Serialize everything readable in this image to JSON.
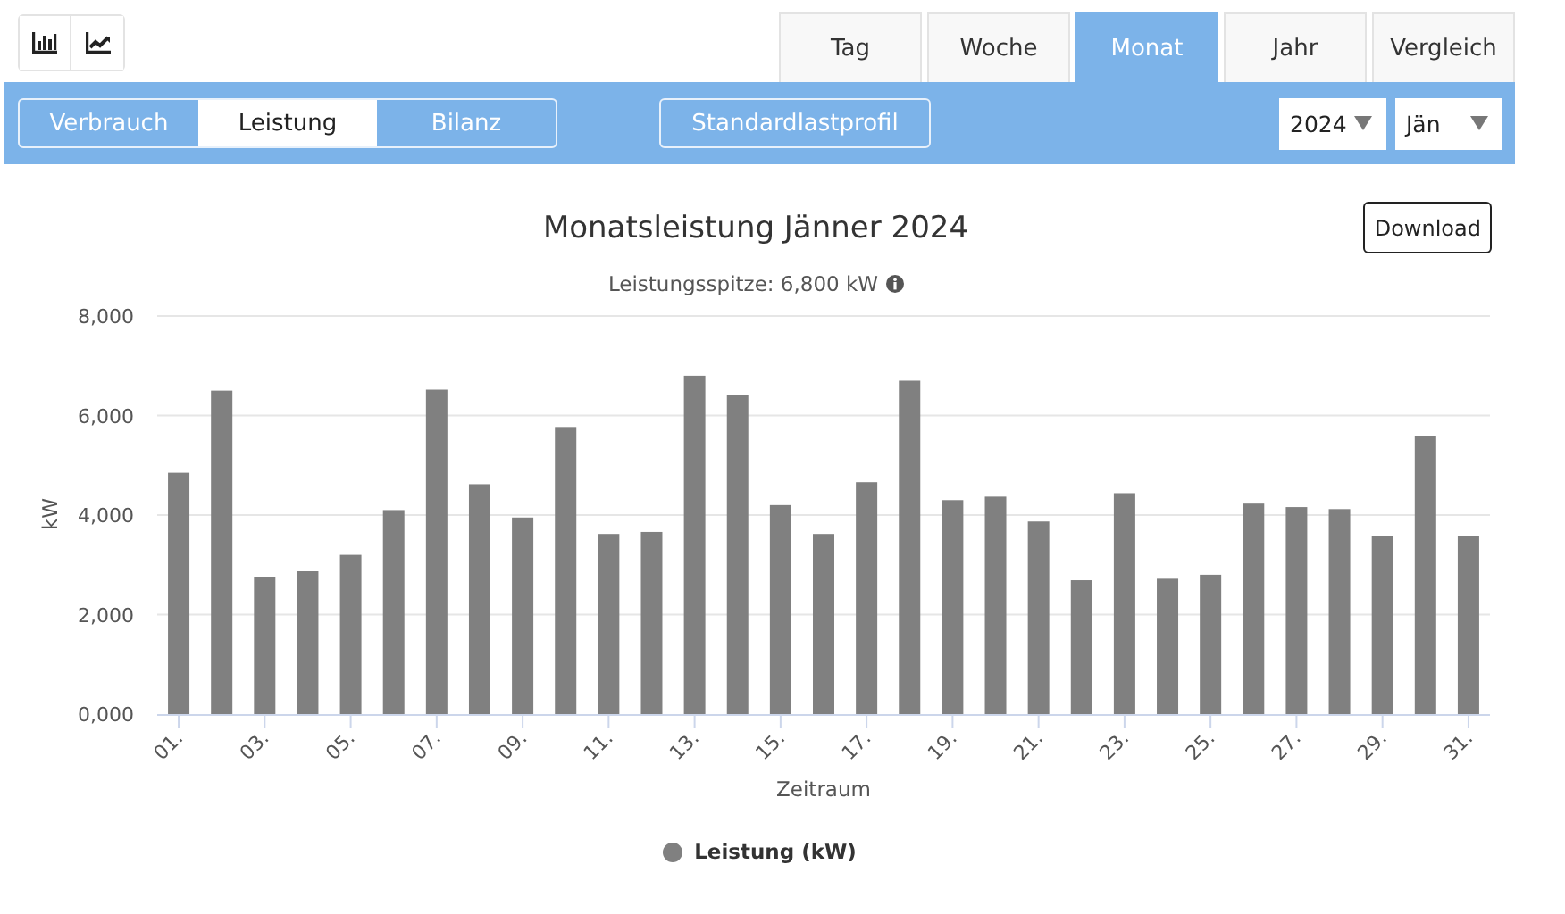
{
  "view_toggle": [
    {
      "kind": "bar",
      "selected": false
    },
    {
      "kind": "line",
      "selected": false
    }
  ],
  "period_tabs": [
    {
      "label": "Tag",
      "selected": false
    },
    {
      "label": "Woche",
      "selected": false
    },
    {
      "label": "Monat",
      "selected": true
    },
    {
      "label": "Jahr",
      "selected": false
    },
    {
      "label": "Vergleich",
      "selected": false
    }
  ],
  "mode_tabs": [
    {
      "label": "Verbrauch",
      "selected": false
    },
    {
      "label": "Leistung",
      "selected": true
    },
    {
      "label": "Bilanz",
      "selected": false
    }
  ],
  "profile_button": "Standardlastprofil",
  "year_select": {
    "value": "2024"
  },
  "month_select": {
    "value": "Jän"
  },
  "download_button": "Download",
  "chart": {
    "subtitle": "Leistungsspitze: 6,800 kW",
    "chart_data": {
      "type": "bar",
      "title": "Monatsleistung Jänner 2024",
      "xlabel": "Zeitraum",
      "ylabel": "kW",
      "ylim": [
        0,
        8000
      ],
      "yticks": [
        {
          "value": 0,
          "label": "0,000"
        },
        {
          "value": 2000,
          "label": "2,000"
        },
        {
          "value": 4000,
          "label": "4,000"
        },
        {
          "value": 6000,
          "label": "6,000"
        },
        {
          "value": 8000,
          "label": "8,000"
        }
      ],
      "grid": true,
      "x": [
        1,
        2,
        3,
        4,
        5,
        6,
        7,
        8,
        9,
        10,
        11,
        12,
        13,
        14,
        15,
        16,
        17,
        18,
        19,
        20,
        21,
        22,
        23,
        24,
        25,
        26,
        27,
        28,
        29,
        30,
        31
      ],
      "xlim": [
        0.5,
        31.5
      ],
      "xticks": [
        {
          "value": 1,
          "label": "01."
        },
        {
          "value": 3,
          "label": "03."
        },
        {
          "value": 5,
          "label": "05."
        },
        {
          "value": 7,
          "label": "07."
        },
        {
          "value": 9,
          "label": "09."
        },
        {
          "value": 11,
          "label": "11."
        },
        {
          "value": 13,
          "label": "13."
        },
        {
          "value": 15,
          "label": "15."
        },
        {
          "value": 17,
          "label": "17."
        },
        {
          "value": 19,
          "label": "19."
        },
        {
          "value": 21,
          "label": "21."
        },
        {
          "value": 23,
          "label": "23."
        },
        {
          "value": 25,
          "label": "25."
        },
        {
          "value": 27,
          "label": "27."
        },
        {
          "value": 29,
          "label": "29."
        },
        {
          "value": 31,
          "label": "31."
        }
      ],
      "series": [
        {
          "name": "Leistung (kW)",
          "color": "#808080",
          "values": [
            4850,
            6500,
            2750,
            2870,
            3200,
            4100,
            6520,
            4620,
            3950,
            5770,
            3620,
            3660,
            6800,
            6420,
            4200,
            3620,
            4660,
            6700,
            4300,
            4370,
            3870,
            2690,
            4440,
            2720,
            2800,
            4230,
            4160,
            4120,
            3580,
            5590,
            3580
          ]
        }
      ]
    }
  }
}
